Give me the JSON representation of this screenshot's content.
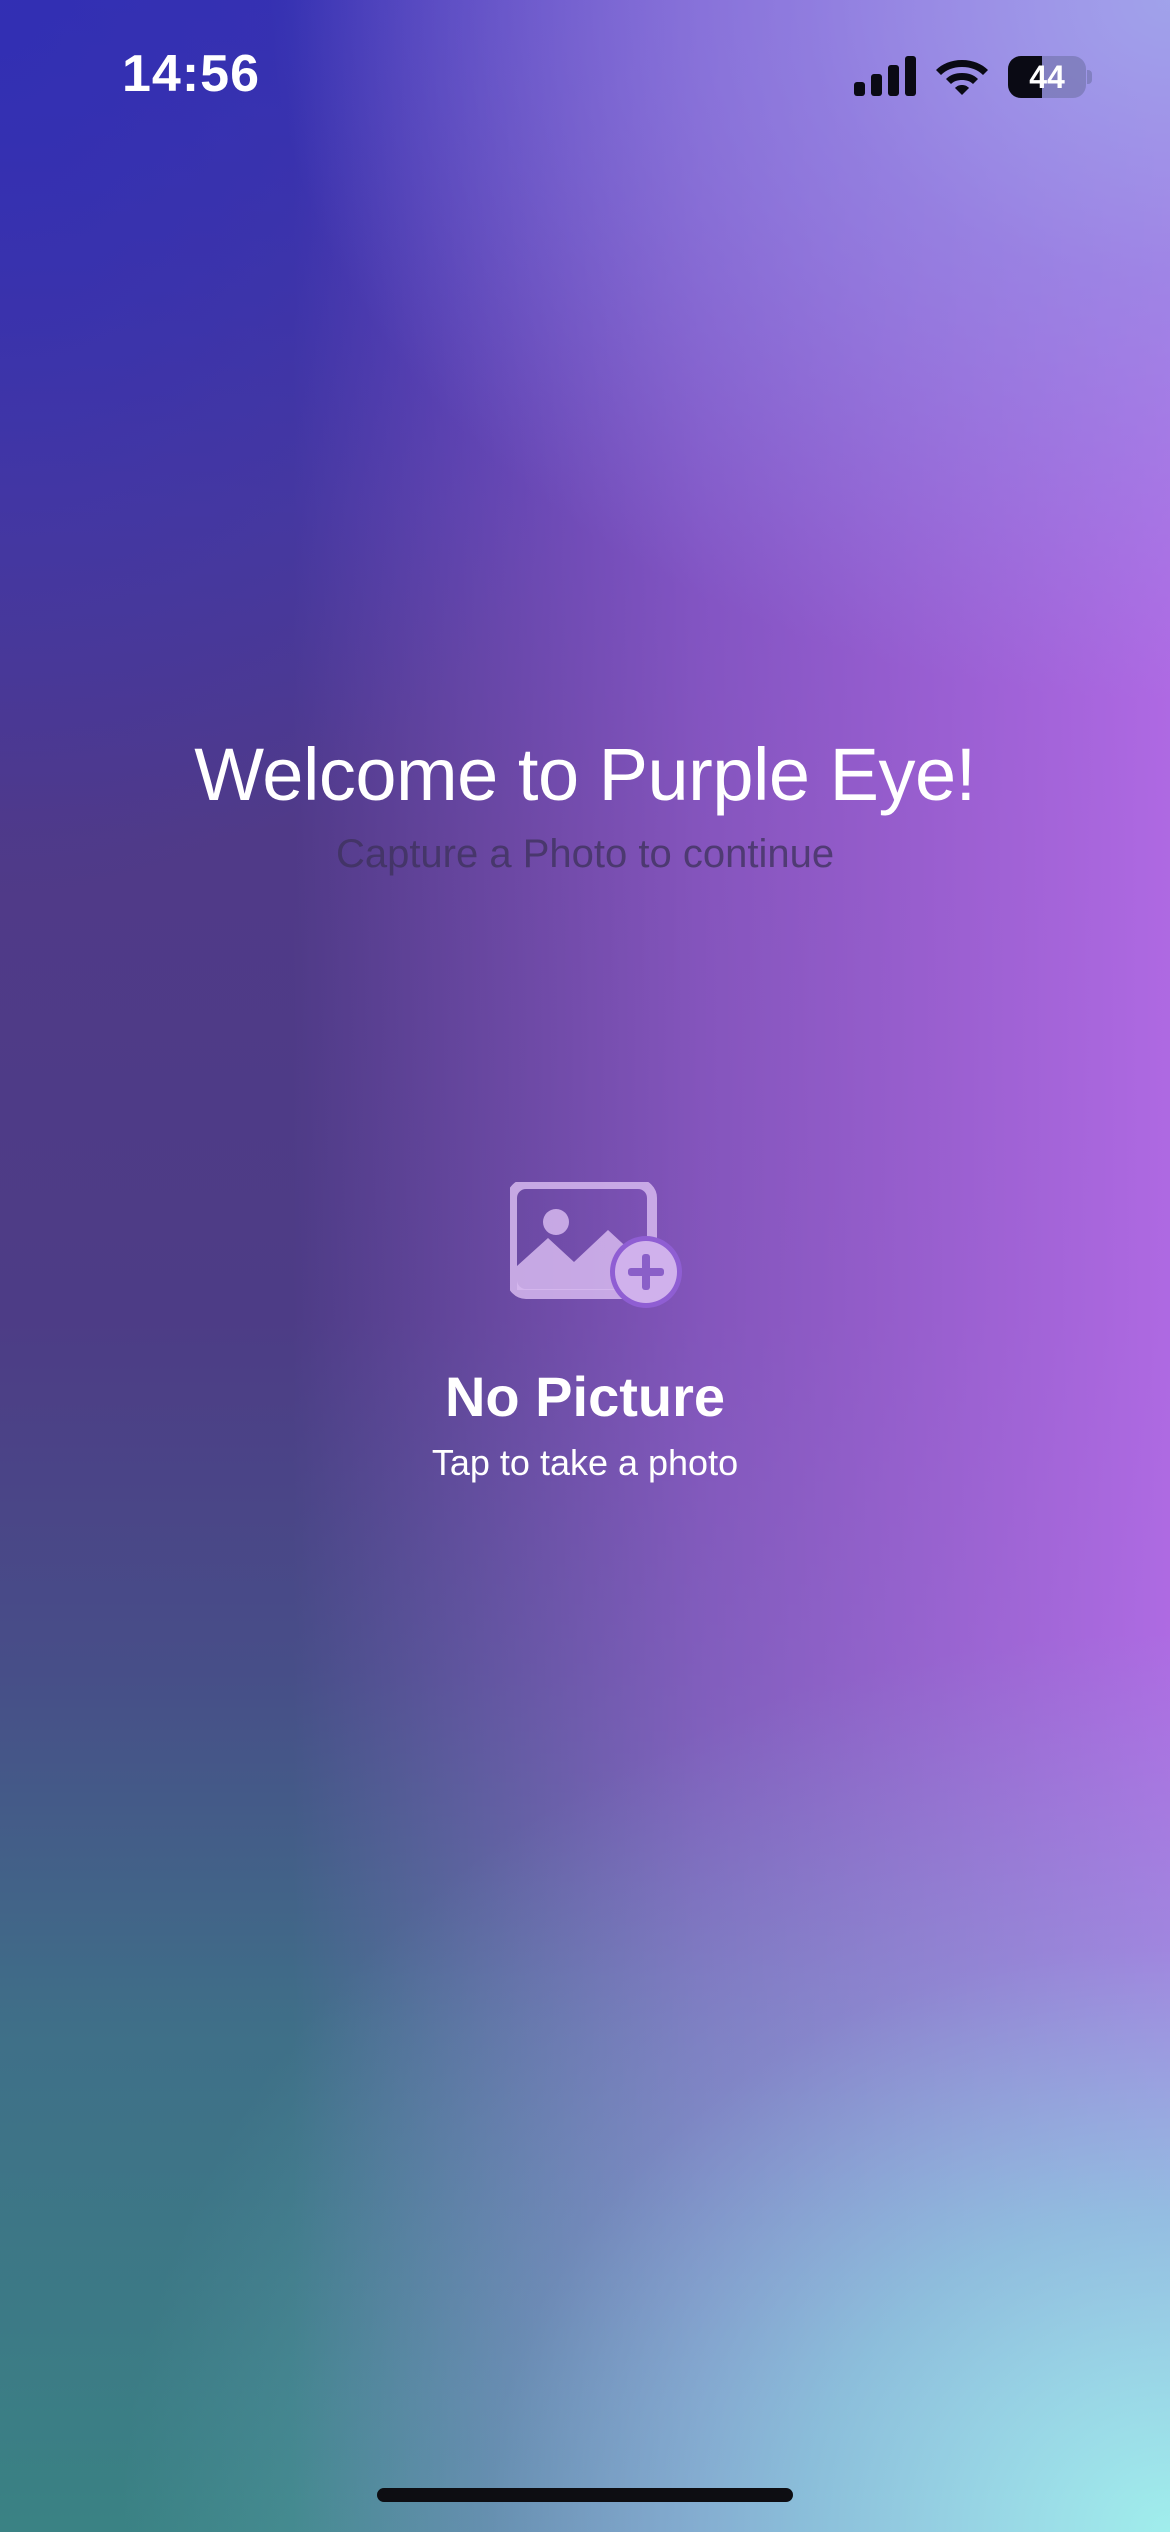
{
  "status_bar": {
    "time": "14:56",
    "battery_level": "44",
    "battery_fraction": 0.44
  },
  "welcome": {
    "title": "Welcome to Purple Eye!",
    "subtitle": "Capture a Photo to continue"
  },
  "picture": {
    "icon": "photo-badge-plus-icon",
    "title": "No Picture",
    "subtitle": "Tap to take a photo"
  },
  "colors": {
    "text_primary": "#ffffff",
    "subtitle_text": "#3c325a",
    "icon_tint": "#d6b8ee"
  }
}
